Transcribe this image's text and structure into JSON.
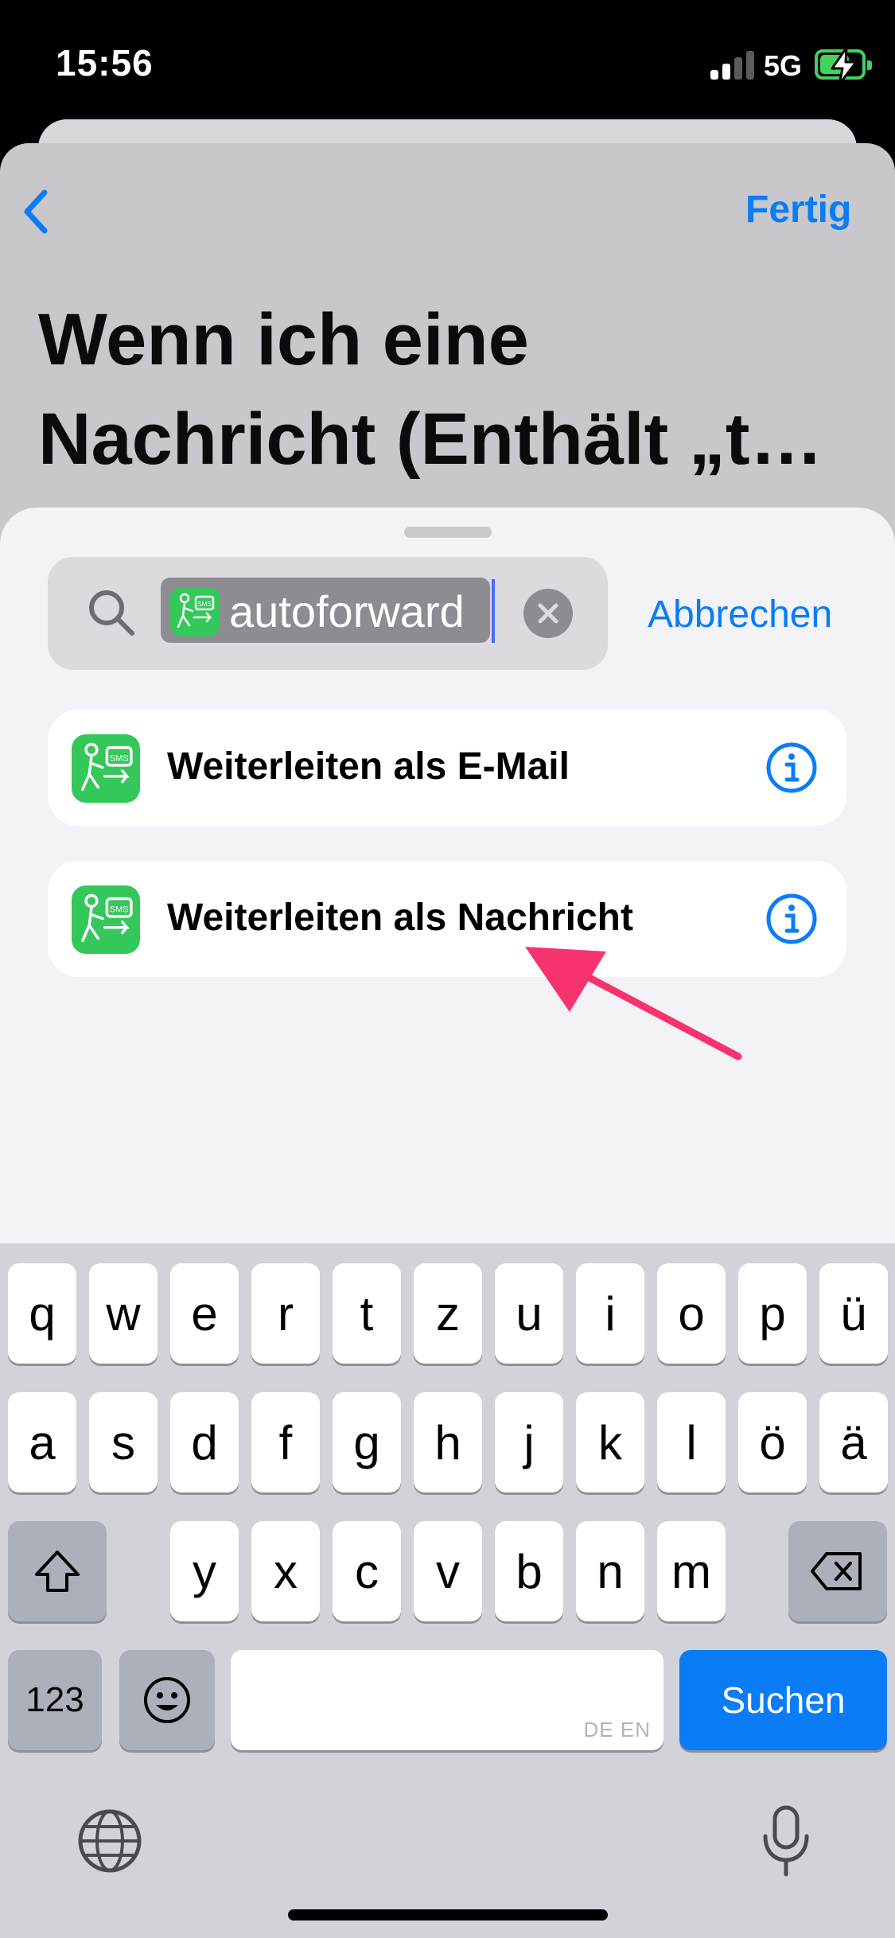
{
  "status_bar": {
    "time": "15:56",
    "network": "5G"
  },
  "header": {
    "done_label": "Fertig",
    "title": "Wenn ich eine Nachricht (Enthält „t…"
  },
  "search": {
    "token_text": "autoforward",
    "cancel_label": "Abbrechen"
  },
  "results": [
    {
      "label": "Weiterleiten als E-Mail"
    },
    {
      "label": "Weiterleiten als Nachricht"
    }
  ],
  "keyboard": {
    "row1": [
      "q",
      "w",
      "e",
      "r",
      "t",
      "z",
      "u",
      "i",
      "o",
      "p",
      "ü"
    ],
    "row2": [
      "a",
      "s",
      "d",
      "f",
      "g",
      "h",
      "j",
      "k",
      "l",
      "ö",
      "ä"
    ],
    "row3": [
      "y",
      "x",
      "c",
      "v",
      "b",
      "n",
      "m"
    ],
    "numbers_label": "123",
    "space_languages": "DE EN",
    "search_label": "Suchen"
  },
  "colors": {
    "accent": "#0a7cf5",
    "app_icon": "#34c759",
    "annotation_arrow": "#f7336f"
  }
}
